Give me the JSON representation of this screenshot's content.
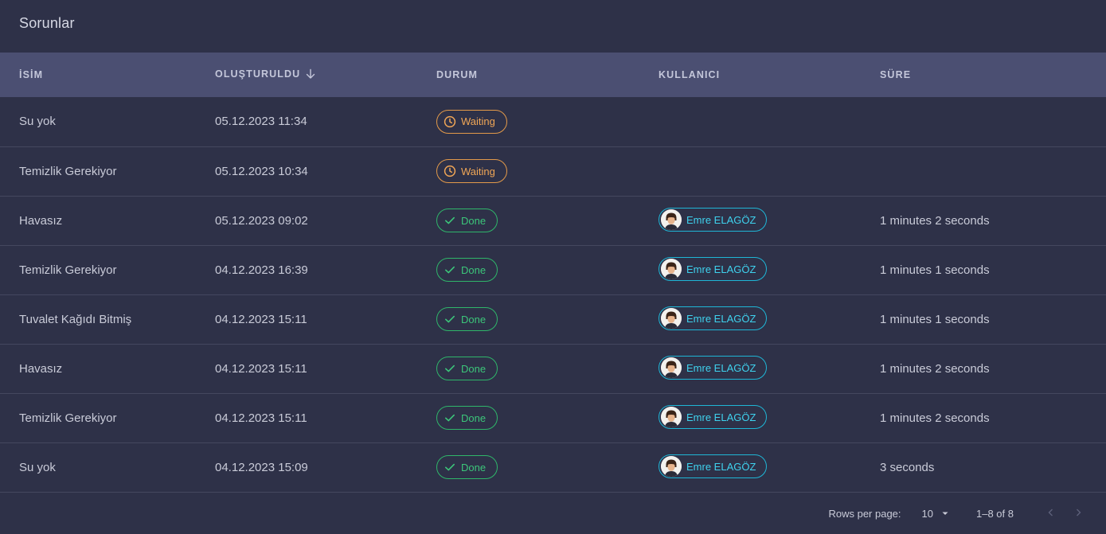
{
  "panel": {
    "title": "Sorunlar"
  },
  "columns": {
    "name": "İSİM",
    "created": "OLUŞTURULDU",
    "status": "DURUM",
    "user": "KULLANICI",
    "duration": "SÜRE"
  },
  "rows": [
    {
      "name": "Su yok",
      "created": "05.12.2023 11:34",
      "status": "Waiting",
      "user": "",
      "duration": ""
    },
    {
      "name": "Temizlik Gerekiyor",
      "created": "05.12.2023 10:34",
      "status": "Waiting",
      "user": "",
      "duration": ""
    },
    {
      "name": "Havasız",
      "created": "05.12.2023 09:02",
      "status": "Done",
      "user": "Emre ELAGÖZ",
      "duration": "1 minutes 2 seconds"
    },
    {
      "name": "Temizlik Gerekiyor",
      "created": "04.12.2023 16:39",
      "status": "Done",
      "user": "Emre ELAGÖZ",
      "duration": "1 minutes 1 seconds"
    },
    {
      "name": "Tuvalet Kağıdı Bitmiş",
      "created": "04.12.2023 15:11",
      "status": "Done",
      "user": "Emre ELAGÖZ",
      "duration": "1 minutes 1 seconds"
    },
    {
      "name": "Havasız",
      "created": "04.12.2023 15:11",
      "status": "Done",
      "user": "Emre ELAGÖZ",
      "duration": "1 minutes 2 seconds"
    },
    {
      "name": "Temizlik Gerekiyor",
      "created": "04.12.2023 15:11",
      "status": "Done",
      "user": "Emre ELAGÖZ",
      "duration": "1 minutes 2 seconds"
    },
    {
      "name": "Su yok",
      "created": "04.12.2023 15:09",
      "status": "Done",
      "user": "Emre ELAGÖZ",
      "duration": "3 seconds"
    }
  ],
  "pagination": {
    "rows_per_page_label": "Rows per page:",
    "rows_per_page_value": "10",
    "range_text": "1–8 of 8"
  },
  "icons": {
    "sort": "arrow-down-icon",
    "waiting": "clock-icon",
    "done": "check-icon",
    "user": "avatar",
    "select": "caret-down-icon",
    "prev": "chevron-left-icon",
    "next": "chevron-right-icon"
  },
  "colors": {
    "background": "#2e3148",
    "header_row": "#4b4f72",
    "waiting": "#f0a656",
    "done": "#3cc67a",
    "user": "#3fd2ee"
  }
}
